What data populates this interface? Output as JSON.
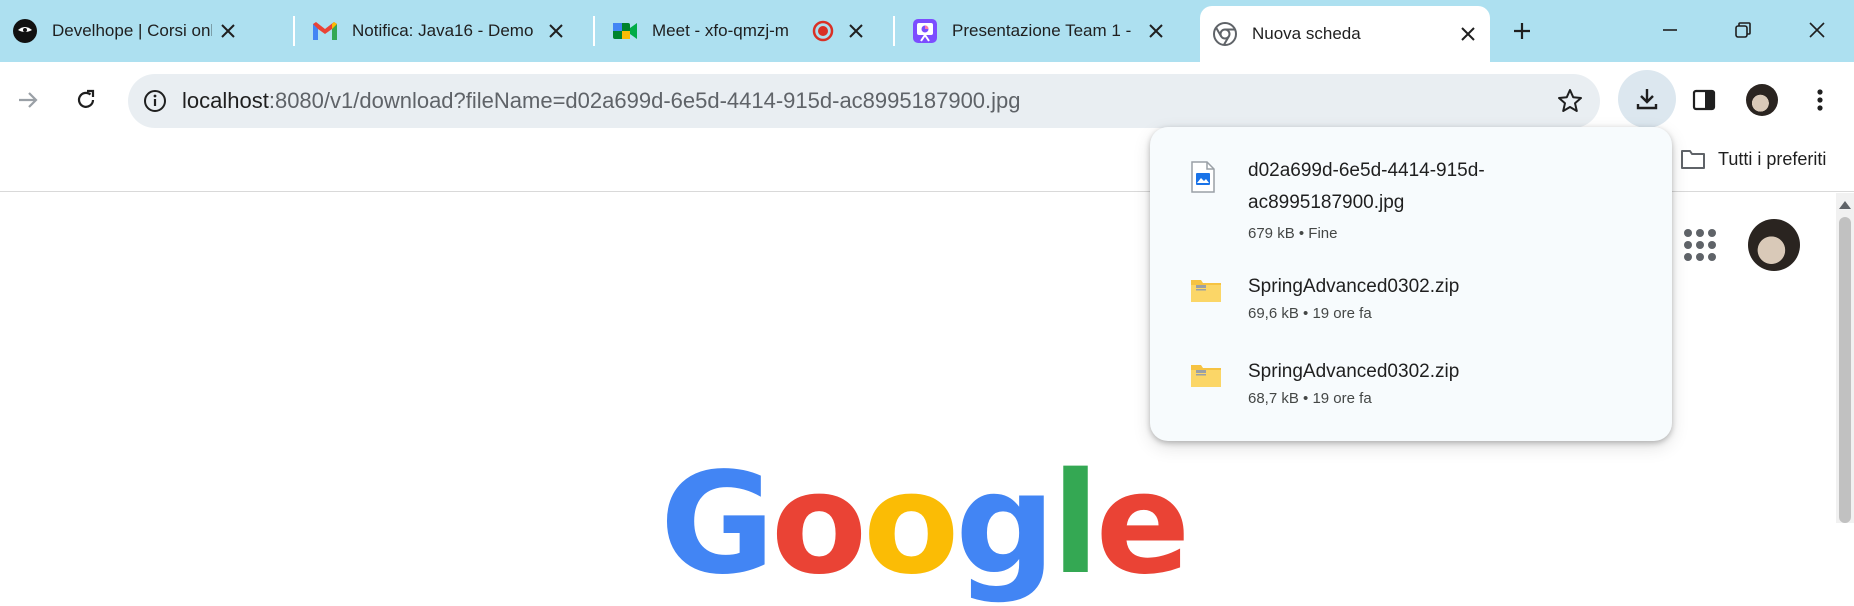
{
  "tabs": [
    {
      "title": "Develhope | Corsi online",
      "icon": "develhope-icon"
    },
    {
      "title": "Notifica: Java16 - Demo",
      "icon": "gmail-icon"
    },
    {
      "title": "Meet - xfo-qmzj-m",
      "icon": "meet-icon"
    },
    {
      "title": "Presentazione Team 1 -",
      "icon": "presentation-icon"
    },
    {
      "title": "Nuova scheda",
      "icon": "chrome-icon",
      "active": true
    }
  ],
  "address_bar": {
    "host": "localhost",
    "rest": ":8080/v1/download?fileName=d02a699d-6e5d-4414-915d-ac8995187900.jpg"
  },
  "bookmarks": {
    "all_bookmarks_label": "Tutti i preferiti"
  },
  "downloads": [
    {
      "name": "d02a699d-6e5d-4414-915d-ac8995187900.jpg",
      "meta": "679 kB • Fine",
      "icon": "image-file-icon"
    },
    {
      "name": "SpringAdvanced0302.zip",
      "meta": "69,6 kB • 19 ore fa",
      "icon": "zip-folder-icon"
    },
    {
      "name": "SpringAdvanced0302.zip",
      "meta": "68,7 kB • 19 ore fa",
      "icon": "zip-folder-icon"
    }
  ],
  "google_logo": [
    "G",
    "o",
    "o",
    "g",
    "l",
    "e"
  ],
  "colors": {
    "tabbar": "#ade0f0",
    "omnibox": "#e9eef2",
    "panel": "#f7fbfd",
    "record_red": "#d93025"
  }
}
